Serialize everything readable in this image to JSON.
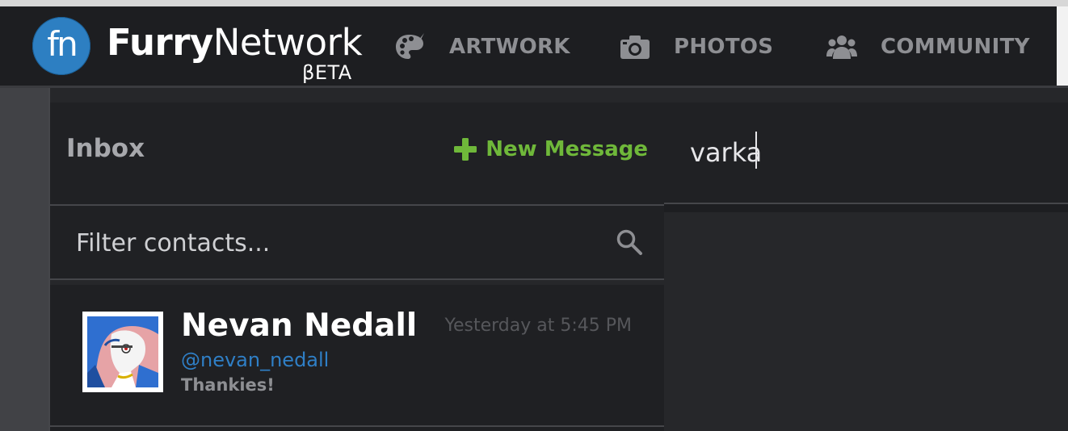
{
  "brand": {
    "logo_mark": "fn",
    "name_bold": "Furry",
    "name_regular": "Network",
    "badge": "βETA"
  },
  "nav": {
    "items": [
      {
        "label": "ARTWORK",
        "icon": "palette-icon"
      },
      {
        "label": "PHOTOS",
        "icon": "camera-icon"
      },
      {
        "label": "COMMUNITY",
        "icon": "users-icon"
      }
    ]
  },
  "inbox": {
    "title": "Inbox",
    "new_message_label": "New Message",
    "new_message_icon": "plus-icon",
    "filter_placeholder": "Filter contacts...",
    "search_icon": "search-icon"
  },
  "contacts": [
    {
      "name": "Nevan Nedall",
      "handle": "@nevan_nedall",
      "preview": "Thankies!",
      "time": "Yesterday at 5:45 PM"
    }
  ],
  "compose": {
    "to_value": "varka"
  },
  "colors": {
    "accent_green": "#6fb83a",
    "link_blue": "#2f7fc6",
    "logo_blue": "#2d7fc2",
    "nav_bg": "#1d1e21",
    "panel_bg": "#202124"
  }
}
